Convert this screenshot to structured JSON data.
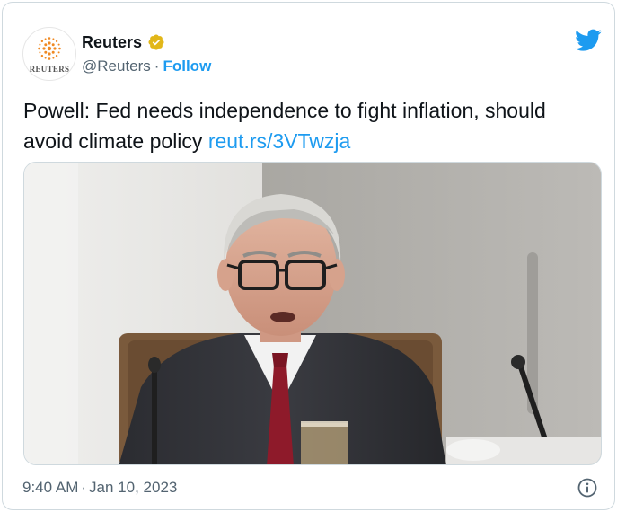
{
  "author": {
    "name": "Reuters",
    "handle": "@Reuters",
    "separator": "·",
    "follow_label": "Follow",
    "avatar_text": "REUTERS",
    "verified_color": "#e2b719"
  },
  "tweet": {
    "text": "Powell: Fed needs independence to fight inflation, should avoid climate policy",
    "link": "reut.rs/3VTwzja",
    "time": "9:40 AM",
    "separator": "·",
    "date": "Jan 10, 2023"
  },
  "icons": {
    "platform": "twitter-bird-icon",
    "info": "info-icon",
    "verified": "verified-badge-icon"
  },
  "colors": {
    "accent": "#1d9bf0",
    "text": "#0f1419",
    "muted": "#536471",
    "border": "#cfd9de",
    "reuters_orange": "#f08a24"
  }
}
